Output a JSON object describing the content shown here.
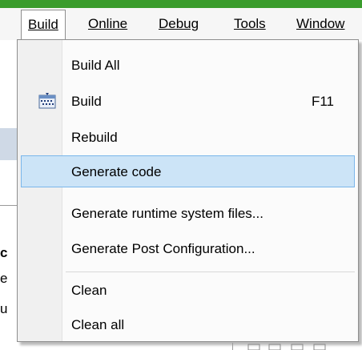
{
  "colors": {
    "accent_strip": "#3a9c2c",
    "highlight_bg": "#cce4f7",
    "highlight_border": "#7ab6ea"
  },
  "menubar": {
    "items": [
      {
        "label": "Build",
        "state": "open"
      },
      {
        "label": "Online"
      },
      {
        "label": "Debug"
      },
      {
        "label": "Tools"
      },
      {
        "label": "Window"
      }
    ]
  },
  "background": {
    "fragments": [
      "c",
      "e",
      "u"
    ]
  },
  "build_menu": {
    "items": [
      {
        "label": "Build All"
      },
      {
        "label": "Build",
        "shortcut": "F11",
        "icon": "build-icon"
      },
      {
        "label": "Rebuild"
      },
      {
        "label": "Generate code",
        "highlighted": true
      },
      {
        "label": "Generate runtime system files..."
      },
      {
        "label": "Generate Post Configuration..."
      },
      {
        "label": "Clean"
      },
      {
        "label": "Clean all"
      }
    ]
  }
}
